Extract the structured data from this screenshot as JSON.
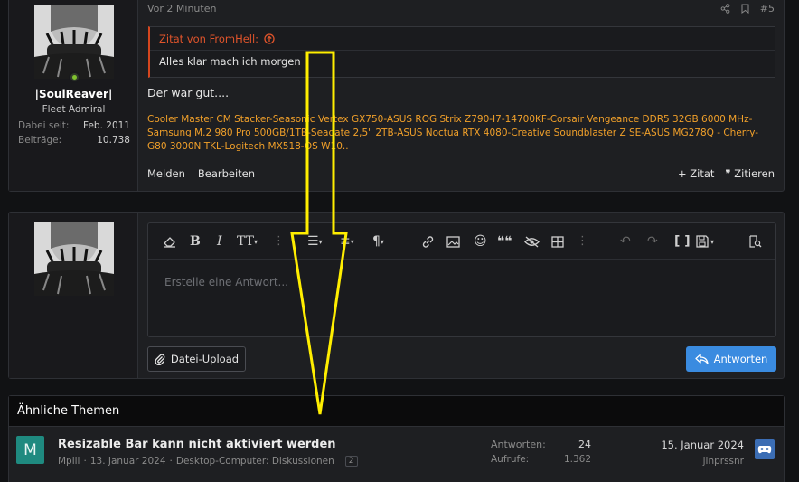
{
  "post": {
    "time": "Vor 2 Minuten",
    "number": "#5",
    "user": {
      "name": "|SoulReaver|",
      "title": "Fleet Admiral",
      "joined_label": "Dabei seit:",
      "joined_value": "Feb. 2011",
      "posts_label": "Beiträge:",
      "posts_value": "10.738"
    },
    "quote": {
      "header": "Zitat von FromHell:",
      "text": "Alles klar mach ich morgen"
    },
    "body": "Der war gut....",
    "signature": "Cooler Master CM Stacker-Seasonic Vertex GX750-ASUS ROG Strix Z790-I7-14700KF-Corsair Vengeance DDR5 32GB 6000 MHz-Samsung M.2 980 Pro 500GB/1TB-Seagate 2,5\" 2TB-ASUS Noctua RTX 4080-Creative Soundblaster Z SE-ASUS MG278Q - Cherry-G80 3000N TKL-Logitech MX518-OS W10..",
    "actions": {
      "report": "Melden",
      "edit": "Bearbeiten",
      "quote": "Zitat",
      "cite": "Zitieren"
    }
  },
  "reply": {
    "placeholder": "Erstelle eine Antwort...",
    "upload_label": "Datei-Upload",
    "send_label": "Antworten"
  },
  "similar": {
    "heading": "Ähnliche Themen",
    "thread": {
      "avatar_letter": "M",
      "title": "Resizable Bar kann nicht aktiviert werden",
      "author": "Mpiii",
      "date": "13. Januar 2024",
      "forum": "Desktop-Computer: Diskussionen",
      "pages": "2",
      "replies_label": "Antworten:",
      "replies_value": "24",
      "views_label": "Aufrufe:",
      "views_value": "1.362",
      "last_date": "15. Januar 2024",
      "last_user": "jlnprssnr"
    }
  },
  "colors": {
    "accent": "#3a8be0",
    "quote_accent": "#e0542b",
    "signature": "#f1a02a",
    "annotation_arrow": "#ffee00"
  }
}
